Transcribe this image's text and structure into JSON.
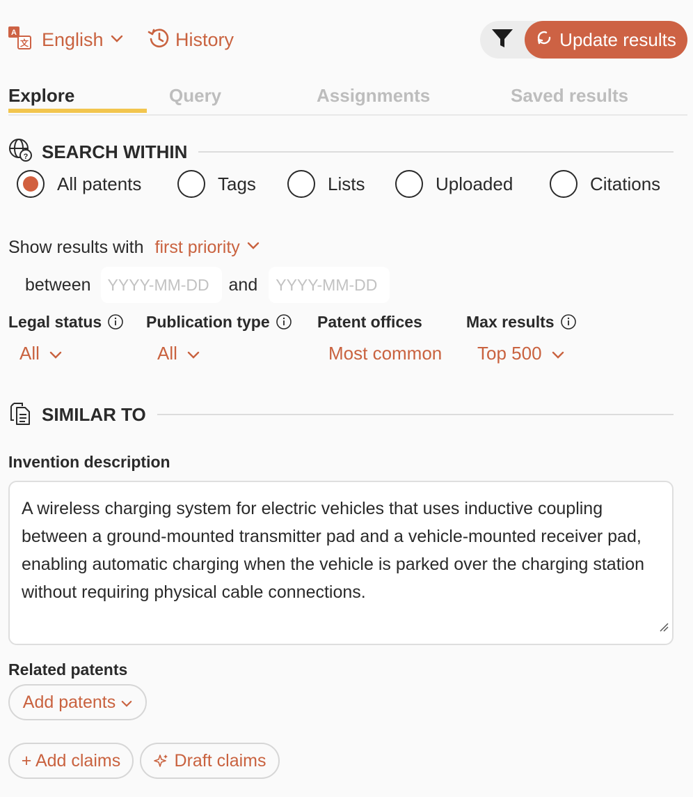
{
  "header": {
    "language": "English",
    "history": "History",
    "update_button": "Update results"
  },
  "tabs": [
    {
      "label": "Explore",
      "active": true
    },
    {
      "label": "Query",
      "active": false
    },
    {
      "label": "Assignments",
      "active": false
    },
    {
      "label": "Saved results",
      "active": false
    }
  ],
  "search_within": {
    "title": "SEARCH WITHIN",
    "options": [
      "All patents",
      "Tags",
      "Lists",
      "Uploaded",
      "Citations"
    ],
    "selected": "All patents"
  },
  "show_results": {
    "label": "Show results with",
    "priority": "first priority",
    "between": "between",
    "and": "and",
    "date_placeholder": "YYYY-MM-DD"
  },
  "filters": {
    "legal_status": {
      "label": "Legal status",
      "value": "All"
    },
    "publication_type": {
      "label": "Publication type",
      "value": "All"
    },
    "patent_offices": {
      "label": "Patent offices",
      "value": "Most common"
    },
    "max_results": {
      "label": "Max results",
      "value": "Top 500"
    }
  },
  "similar_to": {
    "title": "SIMILAR TO",
    "invention_label": "Invention description",
    "invention_text": "A wireless charging system for electric vehicles that uses inductive coupling between a ground-mounted transmitter pad and a vehicle-mounted receiver pad, enabling automatic charging when the vehicle is parked over the charging station without requiring physical cable connections.",
    "related_label": "Related patents",
    "add_patents": "Add patents",
    "add_claims": "+ Add claims",
    "draft_claims": "Draft claims"
  },
  "colors": {
    "accent": "#c9623f",
    "button": "#cd6244",
    "tab_underline": "#f2c54e"
  }
}
